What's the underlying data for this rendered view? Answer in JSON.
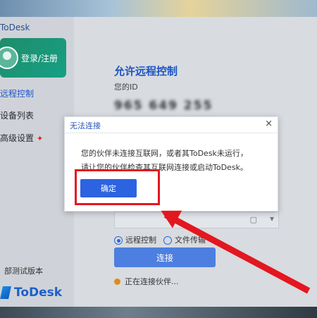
{
  "app": {
    "brand_top": "ToDesk",
    "login_label": "登录/注册",
    "nav": [
      "远程控制",
      "设备列表",
      "高级设置"
    ],
    "beta_label": "部测试版本",
    "logo_text": "ToDesk"
  },
  "main": {
    "title": "允许远程控制",
    "id_label": "您的ID",
    "id_value": "965 649 255",
    "radio_remote": "远程控制",
    "radio_file": "文件传输",
    "connect_label": "连接",
    "status_text": "正在连接伙伴..."
  },
  "dialog": {
    "title": "无法连接",
    "close": "×",
    "line1": "您的伙伴未连接互联网，或者其ToDesk未运行，",
    "line2": "请让您的伙伴检查其互联网连接或启动ToDesk。",
    "ok_label": "确定"
  },
  "colors": {
    "accent": "#2c63e0",
    "annotation": "#e3171f",
    "login_card": "#16a085"
  }
}
